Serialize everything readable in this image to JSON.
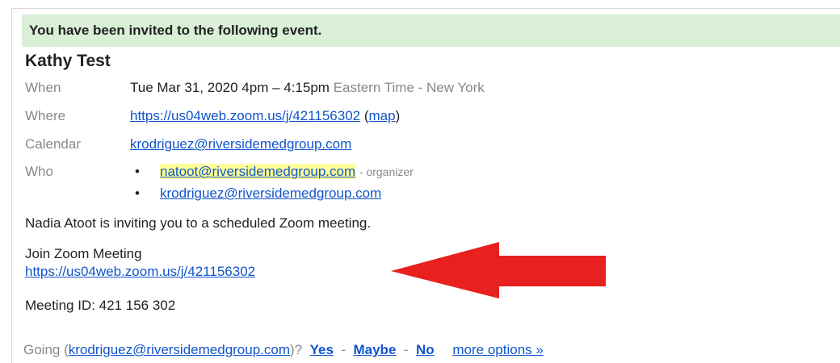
{
  "banner": "You have been invited to the following event.",
  "event": {
    "title": "Kathy Test",
    "when_label": "When",
    "when_value": "Tue Mar 31, 2020 4pm – 4:15pm",
    "when_tz": "Eastern Time - New York",
    "where_label": "Where",
    "where_link": "https://us04web.zoom.us/j/421156302",
    "map_link": "map",
    "calendar_label": "Calendar",
    "calendar_value": "krodriguez@riversidemedgroup.com",
    "who_label": "Who",
    "who": [
      {
        "email": "natoot@riversidemedgroup.com",
        "role": "- organizer"
      },
      {
        "email": "krodriguez@riversidemedgroup.com",
        "role": ""
      }
    ]
  },
  "body": {
    "inviting": "Nadia Atoot is inviting you to a scheduled Zoom meeting.",
    "join_label": "Join Zoom Meeting",
    "join_link": "https://us04web.zoom.us/j/421156302",
    "meeting_id": "Meeting ID: 421 156 302"
  },
  "footer": {
    "going_prefix": "Going (",
    "going_email": "krodriguez@riversidemedgroup.com",
    "going_suffix": ")?",
    "yes": "Yes",
    "maybe": "Maybe",
    "no": "No",
    "separator": "-",
    "more_options": "more options »"
  },
  "colors": {
    "banner_bg": "#d9f0d6",
    "link": "#1155cc",
    "highlight": "#ffff99",
    "arrow": "#e8201f"
  }
}
